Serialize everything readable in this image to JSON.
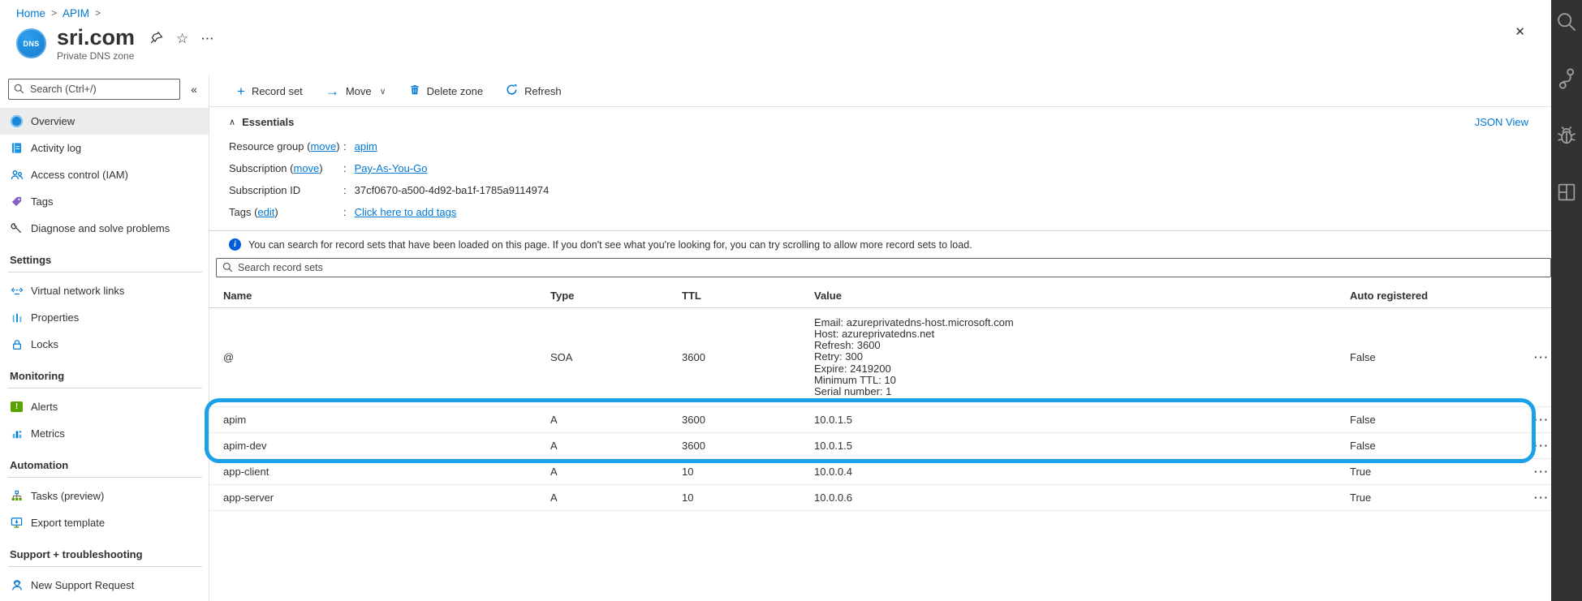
{
  "colors": {
    "accent": "#0078d4",
    "highlight": "#1ba1e6",
    "alert_green": "#57a300"
  },
  "icons": {
    "separator": ">",
    "star": "☆",
    "more": "···",
    "close": "✕",
    "collapse": "«",
    "chevron_up": "∧",
    "chevron_down": "∨",
    "plus": "+",
    "arrow_right": "→",
    "info": "i",
    "exclaim": "!"
  },
  "breadcrumb": {
    "home": "Home",
    "apim": "APIM"
  },
  "header": {
    "title": "sri.com",
    "subtitle": "Private DNS zone",
    "avatar_label": "DNS"
  },
  "sidebar": {
    "search_placeholder": "Search (Ctrl+/)",
    "sections": [
      {
        "label": "",
        "items": [
          {
            "label": "Overview"
          },
          {
            "label": "Activity log"
          },
          {
            "label": "Access control (IAM)"
          },
          {
            "label": "Tags"
          },
          {
            "label": "Diagnose and solve problems"
          }
        ]
      },
      {
        "label": "Settings",
        "items": [
          {
            "label": "Virtual network links"
          },
          {
            "label": "Properties"
          },
          {
            "label": "Locks"
          }
        ]
      },
      {
        "label": "Monitoring",
        "items": [
          {
            "label": "Alerts"
          },
          {
            "label": "Metrics"
          }
        ]
      },
      {
        "label": "Automation",
        "items": [
          {
            "label": "Tasks (preview)"
          },
          {
            "label": "Export template"
          }
        ]
      },
      {
        "label": "Support + troubleshooting",
        "items": [
          {
            "label": "New Support Request"
          }
        ]
      }
    ]
  },
  "toolbar": {
    "record_set": "Record set",
    "move": "Move",
    "delete_zone": "Delete zone",
    "refresh": "Refresh"
  },
  "essentials": {
    "title": "Essentials",
    "json_view": "JSON View",
    "sep": ":",
    "rows": [
      {
        "label": "Resource group (",
        "link": "move",
        "label_end": ")",
        "value": "apim"
      },
      {
        "label": "Subscription (",
        "link": "move",
        "label_end": ")",
        "value": "Pay-As-You-Go"
      },
      {
        "label": "Subscription ID",
        "link": "",
        "label_end": "",
        "value": "37cf0670-a500-4d92-ba1f-1785a9114974"
      },
      {
        "label": "Tags (",
        "link": "edit",
        "label_end": ")",
        "value": "Click here to add tags"
      }
    ]
  },
  "banner": {
    "text": "You can search for record sets that have been loaded on this page. If you don't see what you're looking for, you can try scrolling to allow more record sets to load."
  },
  "record_search": {
    "placeholder": "Search record sets"
  },
  "table": {
    "columns": [
      "Name",
      "Type",
      "TTL",
      "Value",
      "Auto registered"
    ],
    "rows": [
      {
        "name": "@",
        "type": "SOA",
        "ttl": "3600",
        "value_lines": [
          "Email: azureprivatedns-host.microsoft.com",
          "Host: azureprivatedns.net",
          "Refresh: 3600",
          "Retry: 300",
          "Expire: 2419200",
          "Minimum TTL: 10",
          "Serial number: 1"
        ],
        "auto_registered": "False"
      },
      {
        "name": "apim",
        "type": "A",
        "ttl": "3600",
        "value_lines": [
          "10.0.1.5"
        ],
        "auto_registered": "False"
      },
      {
        "name": "apim-dev",
        "type": "A",
        "ttl": "3600",
        "value_lines": [
          "10.0.1.5"
        ],
        "auto_registered": "False"
      },
      {
        "name": "app-client",
        "type": "A",
        "ttl": "10",
        "value_lines": [
          "10.0.0.4"
        ],
        "auto_registered": "True"
      },
      {
        "name": "app-server",
        "type": "A",
        "ttl": "10",
        "value_lines": [
          "10.0.0.6"
        ],
        "auto_registered": "True"
      }
    ]
  },
  "right_rail": {
    "icons": [
      "search",
      "branch",
      "bug",
      "layout"
    ]
  }
}
